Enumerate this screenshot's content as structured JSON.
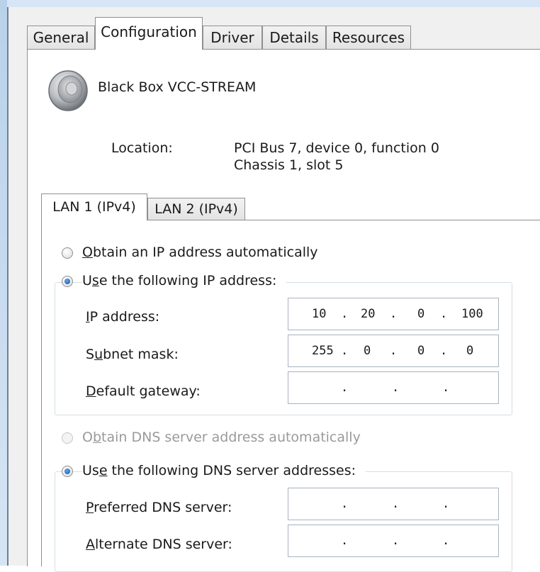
{
  "tabs": [
    "General",
    "Configuration",
    "Driver",
    "Details",
    "Resources"
  ],
  "device": {
    "name": "Black Box VCC-STREAM",
    "icon": "speaker-icon"
  },
  "location": {
    "label": "Location:",
    "line1": "PCI Bus 7, device 0, function 0",
    "line2": "Chassis 1, slot 5"
  },
  "lan_tabs": [
    "LAN 1 (IPv4)",
    "LAN 2 (IPv4)"
  ],
  "ip": {
    "auto_label_pre": "",
    "auto_label_key": "O",
    "auto_label_post": "btain an IP address automatically",
    "manual_label_pre": "U",
    "manual_label_key": "s",
    "manual_label_post": "e the following IP address:",
    "selected": "manual",
    "fields": [
      {
        "pre": "",
        "key": "I",
        "post": "P address:",
        "octets": [
          "10",
          "20",
          "0",
          "100"
        ]
      },
      {
        "pre": "S",
        "key": "u",
        "post": "bnet mask:",
        "octets": [
          "255",
          "0",
          "0",
          "0"
        ]
      },
      {
        "pre": "",
        "key": "D",
        "post": "efault gateway:",
        "octets": [
          "",
          "",
          "",
          ""
        ]
      }
    ]
  },
  "dns": {
    "auto_label_pre": "O",
    "auto_label_key": "b",
    "auto_label_post": "tain DNS server address automatically",
    "auto_enabled": false,
    "manual_label_pre": "Us",
    "manual_label_key": "e",
    "manual_label_post": " the following DNS server addresses:",
    "selected": "manual",
    "fields": [
      {
        "pre": "",
        "key": "P",
        "post": "referred DNS server:",
        "octets": [
          "",
          "",
          "",
          ""
        ]
      },
      {
        "pre": "",
        "key": "A",
        "post": "lternate DNS server:",
        "octets": [
          "",
          "",
          "",
          ""
        ]
      }
    ]
  },
  "colors": {
    "radio_selected": "#1b4f9c",
    "frame": "#d7e6f6",
    "disabled_text": "#9a9a9a"
  }
}
